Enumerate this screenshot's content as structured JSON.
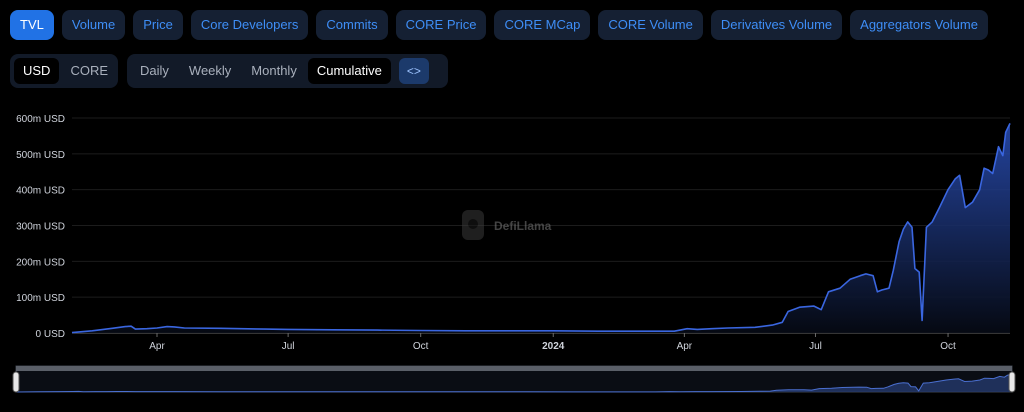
{
  "tabs": [
    {
      "label": "TVL",
      "active": true
    },
    {
      "label": "Volume",
      "active": false
    },
    {
      "label": "Price",
      "active": false
    },
    {
      "label": "Core Developers",
      "active": false
    },
    {
      "label": "Commits",
      "active": false
    },
    {
      "label": "CORE Price",
      "active": false
    },
    {
      "label": "CORE MCap",
      "active": false
    },
    {
      "label": "CORE Volume",
      "active": false
    },
    {
      "label": "Derivatives Volume",
      "active": false
    },
    {
      "label": "Aggregators Volume",
      "active": false
    }
  ],
  "currency": {
    "usd": "USD",
    "core": "CORE",
    "selected": "USD"
  },
  "intervals": {
    "daily": "Daily",
    "weekly": "Weekly",
    "monthly": "Monthly",
    "cumulative": "Cumulative",
    "selected": "Cumulative",
    "embed_icon": "code-icon",
    "embed_label": "<>"
  },
  "watermark": {
    "text": "DefiLlama",
    "icon": "llama-logo-icon"
  },
  "colors": {
    "line": "#3a66e0",
    "fill_top": "#2a4fb8",
    "fill_bottom": "#060a14",
    "grid": "#1c1c1c",
    "axis_text": "#d0d4dc",
    "tab_active": "#2172e5",
    "tab_text": "#3e8ef7"
  },
  "chart_data": {
    "type": "area",
    "title": "",
    "xlabel": "",
    "ylabel": "",
    "y_unit": "USD",
    "ylim": [
      0,
      600
    ],
    "yticks": [
      "0 USD",
      "100m USD",
      "200m USD",
      "300m USD",
      "400m USD",
      "500m USD",
      "600m USD"
    ],
    "xticks": [
      {
        "label": "Apr",
        "date": "2023-04-01",
        "bold": false
      },
      {
        "label": "Jul",
        "date": "2023-07-01",
        "bold": false
      },
      {
        "label": "Oct",
        "date": "2023-10-01",
        "bold": false
      },
      {
        "label": "2024",
        "date": "2024-01-01",
        "bold": true
      },
      {
        "label": "Apr",
        "date": "2024-04-01",
        "bold": false
      },
      {
        "label": "Jul",
        "date": "2024-07-01",
        "bold": false
      },
      {
        "label": "Oct",
        "date": "2024-10-01",
        "bold": false
      }
    ],
    "xlim": [
      "2023-02-01",
      "2024-11-13"
    ],
    "grid": true,
    "legend": "none",
    "series": [
      {
        "values_unit": "million USD",
        "points": [
          [
            "2023-02-01",
            1
          ],
          [
            "2023-02-15",
            6
          ],
          [
            "2023-03-01",
            13
          ],
          [
            "2023-03-10",
            18
          ],
          [
            "2023-03-14",
            19
          ],
          [
            "2023-03-17",
            11
          ],
          [
            "2023-03-25",
            12
          ],
          [
            "2023-04-01",
            14
          ],
          [
            "2023-04-08",
            18
          ],
          [
            "2023-04-13",
            17
          ],
          [
            "2023-04-20",
            14
          ],
          [
            "2023-05-15",
            13
          ],
          [
            "2023-06-15",
            11
          ],
          [
            "2023-07-01",
            10
          ],
          [
            "2023-08-01",
            9
          ],
          [
            "2023-09-01",
            8
          ],
          [
            "2023-10-01",
            7
          ],
          [
            "2023-11-01",
            6
          ],
          [
            "2023-12-01",
            6
          ],
          [
            "2024-01-01",
            6
          ],
          [
            "2024-02-01",
            5
          ],
          [
            "2024-03-01",
            5
          ],
          [
            "2024-03-25",
            5
          ],
          [
            "2024-04-03",
            12
          ],
          [
            "2024-04-10",
            10
          ],
          [
            "2024-04-20",
            12
          ],
          [
            "2024-05-01",
            14
          ],
          [
            "2024-05-20",
            16
          ],
          [
            "2024-06-01",
            22
          ],
          [
            "2024-06-08",
            30
          ],
          [
            "2024-06-12",
            60
          ],
          [
            "2024-06-20",
            72
          ],
          [
            "2024-06-30",
            75
          ],
          [
            "2024-07-05",
            65
          ],
          [
            "2024-07-10",
            115
          ],
          [
            "2024-07-18",
            125
          ],
          [
            "2024-07-25",
            150
          ],
          [
            "2024-08-01",
            160
          ],
          [
            "2024-08-05",
            165
          ],
          [
            "2024-08-10",
            160
          ],
          [
            "2024-08-13",
            115
          ],
          [
            "2024-08-16",
            120
          ],
          [
            "2024-08-21",
            125
          ],
          [
            "2024-08-24",
            175
          ],
          [
            "2024-08-28",
            255
          ],
          [
            "2024-08-31",
            290
          ],
          [
            "2024-09-03",
            310
          ],
          [
            "2024-09-06",
            295
          ],
          [
            "2024-09-08",
            180
          ],
          [
            "2024-09-11",
            170
          ],
          [
            "2024-09-13",
            35
          ],
          [
            "2024-09-16",
            295
          ],
          [
            "2024-09-20",
            310
          ],
          [
            "2024-09-25",
            350
          ],
          [
            "2024-10-01",
            400
          ],
          [
            "2024-10-06",
            430
          ],
          [
            "2024-10-09",
            440
          ],
          [
            "2024-10-13",
            350
          ],
          [
            "2024-10-18",
            365
          ],
          [
            "2024-10-23",
            400
          ],
          [
            "2024-10-26",
            460
          ],
          [
            "2024-10-29",
            455
          ],
          [
            "2024-11-01",
            445
          ],
          [
            "2024-11-05",
            520
          ],
          [
            "2024-11-08",
            495
          ],
          [
            "2024-11-10",
            560
          ],
          [
            "2024-11-13",
            585
          ]
        ]
      }
    ]
  }
}
